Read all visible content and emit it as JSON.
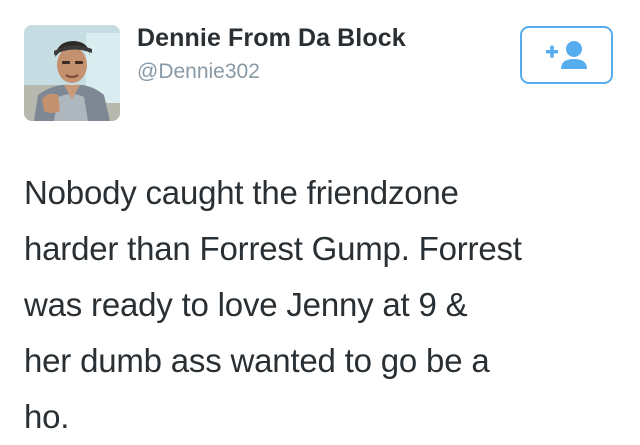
{
  "tweet": {
    "author": {
      "display_name": "Dennie From Da Block",
      "handle": "@Dennie302",
      "avatar_icon": "user-photo-avatar"
    },
    "follow_button": {
      "icon": "follow-user-icon",
      "accent_color": "#55acee"
    },
    "text": "Nobody caught the friendzone\nharder than Forrest Gump. Forrest\nwas ready to love Jenny at 9 &\nher dumb ass wanted to go be a\nho."
  }
}
